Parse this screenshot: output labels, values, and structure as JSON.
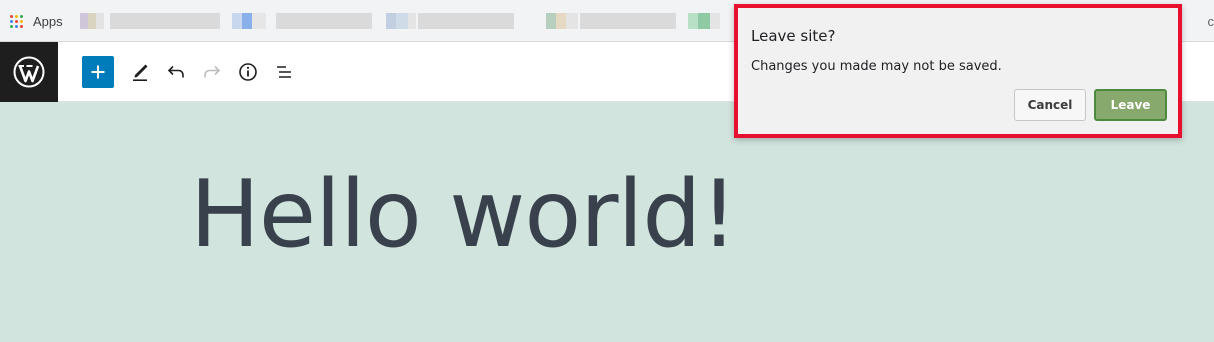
{
  "browser": {
    "bookmarks": {
      "apps_label": "Apps",
      "edge_glyph": "c"
    }
  },
  "editor": {
    "toolbar": {
      "logo_icon": "wordpress-logo-icon",
      "add_block_icon": "plus-icon",
      "tools_icon": "pencil-icon",
      "undo_icon": "undo-icon",
      "redo_icon": "redo-icon",
      "details_icon": "info-icon",
      "list_view_icon": "list-view-icon"
    },
    "post_title": "Hello world!"
  },
  "dialog": {
    "title": "Leave site?",
    "message": "Changes you made may not be saved.",
    "cancel_label": "Cancel",
    "leave_label": "Leave"
  },
  "colors": {
    "canvas_background": "#d1e4dd",
    "title_text": "#39414d",
    "add_block_blue": "#007cba",
    "logo_background": "#1e1e1e",
    "leave_button": "#88a96e",
    "highlight_border": "#e8102e"
  }
}
